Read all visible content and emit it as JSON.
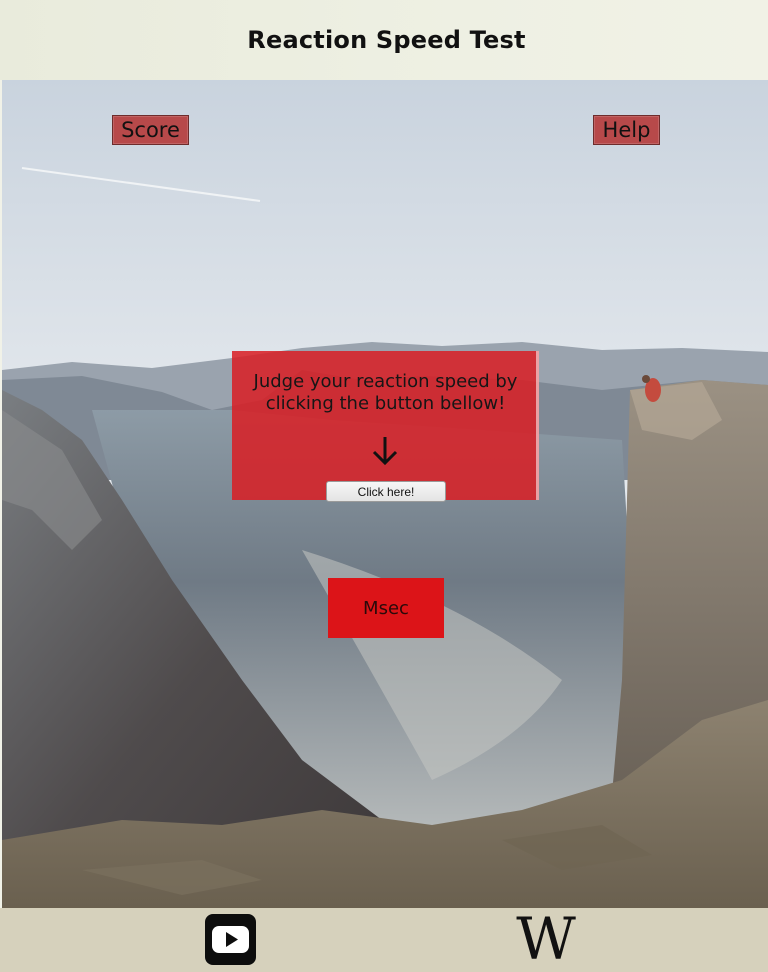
{
  "header": {
    "title": "Reaction Speed Test"
  },
  "nav": {
    "score_label": "Score",
    "help_label": "Help"
  },
  "panel": {
    "line1": "Judge your reaction speed by",
    "line2": "clicking the button bellow!",
    "arrow_icon": "arrow-down-icon",
    "button_label": "Click here!"
  },
  "result": {
    "label": "Msec"
  },
  "footer": {
    "youtube_icon": "youtube-icon",
    "wikipedia_glyph": "W"
  },
  "colors": {
    "panel": "#d81e24",
    "msec_box": "#dc1418",
    "nav_button": "#b7494a",
    "footer": "#d6d1bc"
  }
}
